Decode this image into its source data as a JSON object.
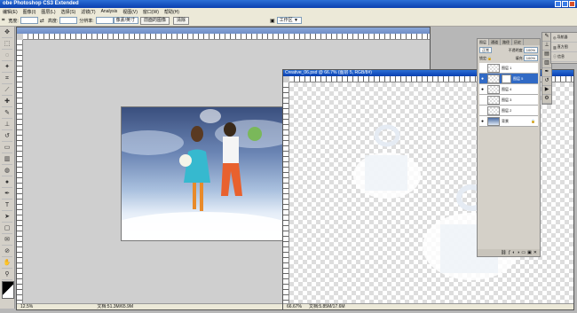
{
  "window": {
    "title": "obe Photoshop CS3 Extended"
  },
  "menu": [
    "编辑(E)",
    "图像(I)",
    "图层(L)",
    "选择(S)",
    "滤镜(T)",
    "Analysis",
    "视图(V)",
    "窗口(W)",
    "帮助(H)"
  ],
  "options": {
    "width_label": "宽度:",
    "height_label": "高度:",
    "resolution_label": "分辨率:",
    "unit_select": "像素/英寸",
    "front_image_button": "前面的图像",
    "clear_button": "清除",
    "workspace_label": "工作区 ▼"
  },
  "left_document": {
    "status_zoom": "12.5%",
    "status_doc": "文档:51.3M/65.9M"
  },
  "right_document": {
    "title": "Creative_06.psd @ 66.7% (图层 5, RGB/8#)",
    "status_zoom": "66.67%",
    "status_doc": "文档:5.85M/17.6M"
  },
  "layers_panel": {
    "tabs": [
      "图层",
      "通道",
      "路径",
      "历史"
    ],
    "blend_mode": "正常",
    "opacity_label": "不透明度:",
    "opacity": "100%",
    "lock_label": "锁定:",
    "fill_label": "填充:",
    "fill": "100%",
    "layers": [
      {
        "name": "图层 1",
        "selected": false,
        "visible": false
      },
      {
        "name": "图层 5",
        "selected": true,
        "visible": true
      },
      {
        "name": "图层 4",
        "selected": false,
        "visible": true
      },
      {
        "name": "图层 3",
        "selected": false,
        "visible": false
      },
      {
        "name": "图层 2",
        "selected": false,
        "visible": false
      },
      {
        "name": "背景",
        "selected": false,
        "visible": true
      }
    ]
  },
  "side_panel": {
    "items": [
      "导航器",
      "直方图",
      "信息"
    ]
  }
}
